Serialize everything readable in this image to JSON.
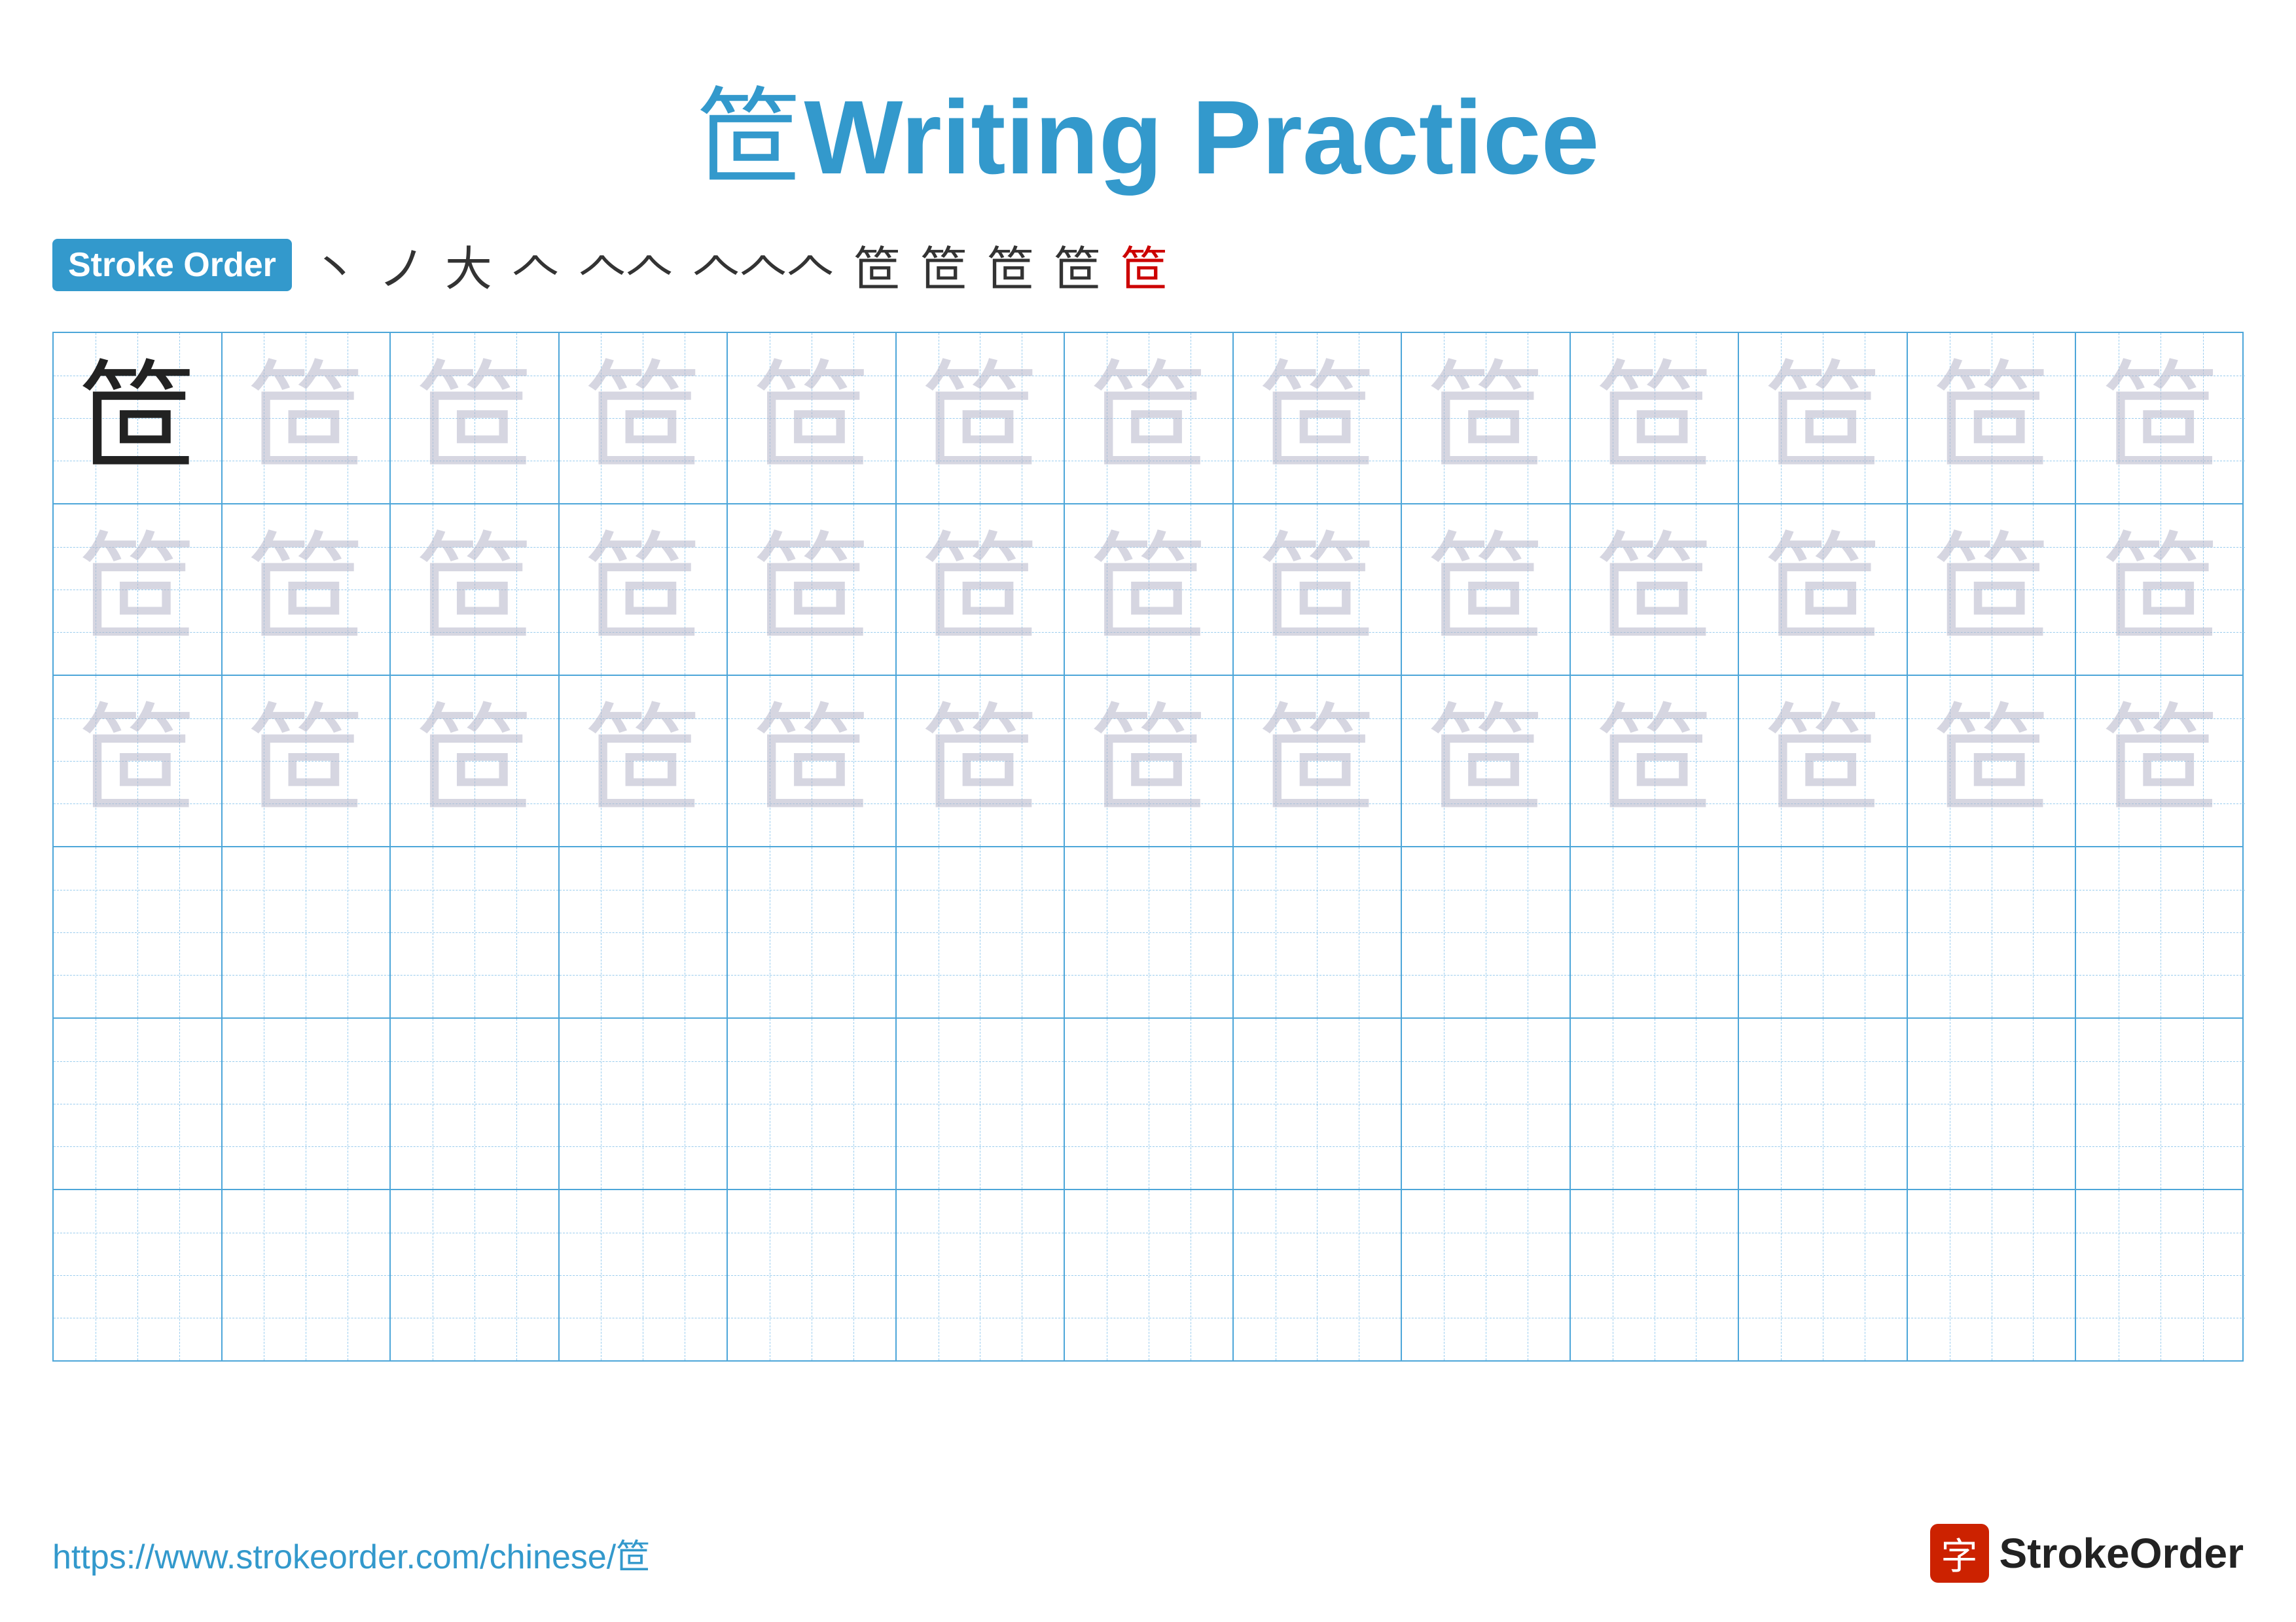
{
  "title": {
    "character": "笸",
    "label": "Writing Practice"
  },
  "stroke_order": {
    "badge_label": "Stroke Order",
    "steps": [
      "丶",
      "ノ",
      "大",
      "𠆢",
      "𠆢𠆢",
      "𠆢𠆢𠆢",
      "竹",
      "笸",
      "笸",
      "笸",
      "笸"
    ],
    "final_char": "笸"
  },
  "grid": {
    "rows": 6,
    "cols": 13,
    "practice_char": "笸",
    "row_types": [
      "solid_then_faded",
      "faded",
      "faded",
      "empty",
      "empty",
      "empty"
    ]
  },
  "footer": {
    "url": "https://www.strokeorder.com/chinese/笸",
    "brand_icon": "字",
    "brand_name": "StrokeOrder"
  }
}
